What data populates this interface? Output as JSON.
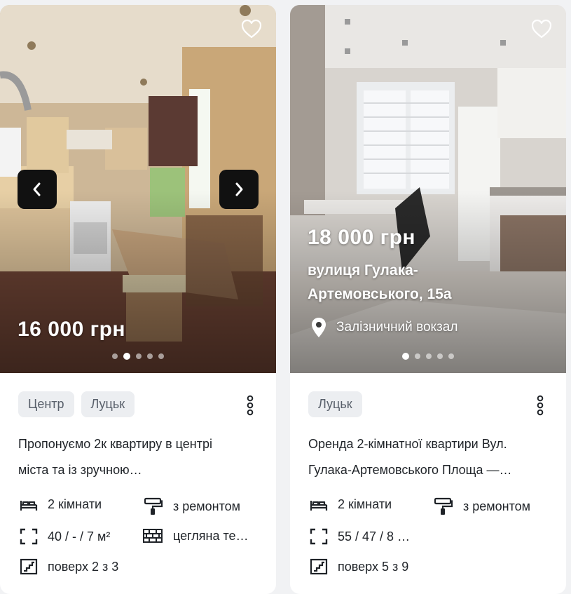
{
  "listings": [
    {
      "price": "16 000 грн",
      "address": "",
      "location": "",
      "slide_active": 2,
      "slide_total": 5,
      "tags": [
        "Центр",
        "Луцьк"
      ],
      "description": [
        "Пропонуємо 2к квартиру в центрі",
        "міста та із зручною…"
      ],
      "features": {
        "rooms": "2 кімнати",
        "repair": "з ремонтом",
        "area": "40 / - / 7 м²",
        "walls": "цегляна те…",
        "floor": "поверх 2 з 3"
      },
      "icons": {
        "favorite": "heart-icon",
        "prev": "chevron-left-icon",
        "next": "chevron-right-icon",
        "more": "vertical-dots-icon"
      }
    },
    {
      "price": "18 000 грн",
      "address": "вулиця Гулака-\nАртемовського, 15а",
      "location": "Залізничний вокзал",
      "slide_active": 1,
      "slide_total": 5,
      "tags": [
        "Луцьк"
      ],
      "description": [
        "Оренда 2-кімнатної квартири Вул.",
        "Гулака-Артемовського Площа —…"
      ],
      "features": {
        "rooms": "2 кімнати",
        "repair": "з ремонтом",
        "area": "55 / 47 / 8 …",
        "floor": "поверх 5 з 9"
      },
      "icons": {
        "favorite": "heart-icon",
        "pin": "map-pin-icon",
        "more": "vertical-dots-icon"
      }
    }
  ],
  "colors": {
    "text": "#1f2328",
    "tag_bg": "#eceef1",
    "tag_text": "#59606b",
    "nav_bg": "#111111"
  }
}
